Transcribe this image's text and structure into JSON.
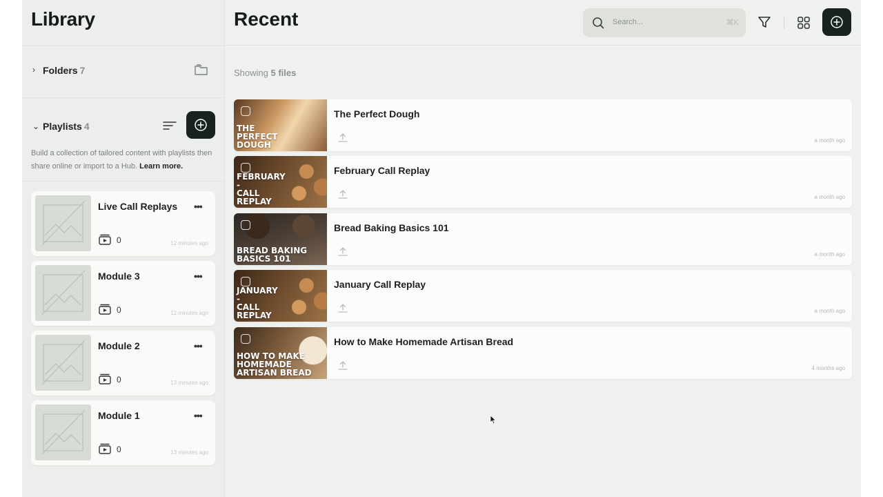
{
  "sidebar": {
    "title": "Library",
    "folders": {
      "label": "Folders",
      "count": "7"
    },
    "playlists": {
      "label": "Playlists",
      "count": "4",
      "description": "Build a collection of tailored content with playlists then share online or import to a Hub.",
      "learn_more": "Learn more."
    },
    "playlist_items": [
      {
        "title": "Live Call Replays",
        "count": "0",
        "time": "12 minutes ago"
      },
      {
        "title": "Module 3",
        "count": "0",
        "time": "12 minutes ago"
      },
      {
        "title": "Module 2",
        "count": "0",
        "time": "13 minutes ago"
      },
      {
        "title": "Module 1",
        "count": "0",
        "time": "13 minutes ago"
      }
    ]
  },
  "main": {
    "title": "Recent",
    "search": {
      "placeholder": "Search...",
      "shortcut": "⌘K"
    },
    "showing_prefix": "Showing",
    "showing_count": "5 files",
    "files": [
      {
        "title": "The Perfect Dough",
        "thumb_text": "THE\nPERFECT\nDOUGH",
        "time": "a month ago"
      },
      {
        "title": "February Call Replay",
        "thumb_text": "FEBRUARY\n-\nCALL\nREPLAY",
        "time": "a month ago"
      },
      {
        "title": "Bread Baking Basics 101",
        "thumb_text": "BREAD BAKING\nBASICS 101",
        "time": "a month ago"
      },
      {
        "title": "January Call Replay",
        "thumb_text": "JANUARY\n-\nCALL\nREPLAY",
        "time": "a month ago"
      },
      {
        "title": "How to Make Homemade Artisan Bread",
        "thumb_text": "HOW TO MAKE\nHOMEMADE\nARTISAN BREAD",
        "time": "4 months ago"
      }
    ]
  },
  "colors": {
    "accent_dark": "#17231c",
    "background": "#eff1ee",
    "card": "#fcfcfb"
  },
  "icons": [
    "chevron-right-icon",
    "folder-icon",
    "chevron-down-icon",
    "sort-icon",
    "add-icon",
    "search-icon",
    "filter-icon",
    "grid-icon",
    "upload-icon",
    "playlist-video-icon",
    "more-icon"
  ]
}
